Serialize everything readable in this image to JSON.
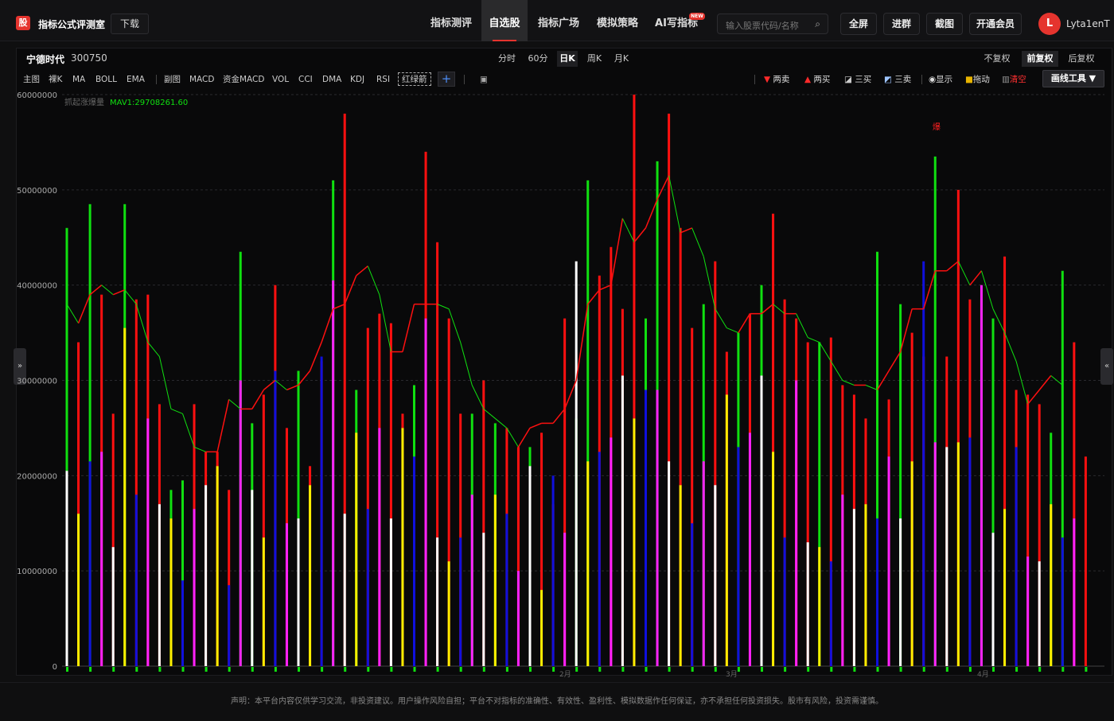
{
  "app": {
    "logo_char": "股",
    "title": "指标公式评测室",
    "download": "下载"
  },
  "nav": [
    {
      "label": "指标测评",
      "active": false
    },
    {
      "label": "自选股",
      "active": true
    },
    {
      "label": "指标广场",
      "active": false
    },
    {
      "label": "模拟策略",
      "active": false
    },
    {
      "label": "AI写指标",
      "active": false
    }
  ],
  "new_badge": "NEW",
  "search": {
    "placeholder": "输入股票代码/名称"
  },
  "top_buttons": [
    "全屏",
    "进群",
    "截图",
    "开通会员"
  ],
  "user": {
    "initial": "L",
    "name": "Lyta1enT"
  },
  "stock": {
    "name": "宁德时代",
    "code": "300750"
  },
  "periods": [
    {
      "label": "分时",
      "active": false
    },
    {
      "label": "60分",
      "active": false
    },
    {
      "label": "日K",
      "active": true
    },
    {
      "label": "周K",
      "active": false
    },
    {
      "label": "月K",
      "active": false
    }
  ],
  "adjust": [
    {
      "label": "不复权",
      "active": false
    },
    {
      "label": "前复权",
      "active": true
    },
    {
      "label": "后复权",
      "active": false
    }
  ],
  "indicators_main": [
    "主图",
    "裸K",
    "MA",
    "BOLL",
    "EMA"
  ],
  "indicators_sub": [
    "副图",
    "MACD",
    "资金MACD",
    "VOL",
    "CCI",
    "DMA",
    "KDJ",
    "RSI"
  ],
  "indicator_boxed": "红绿箭",
  "tools": {
    "sell2": "两卖",
    "buy2": "两买",
    "buy3": "三买",
    "sell3": "三卖",
    "show": "显示",
    "drag": "拖动",
    "clear": "清空",
    "draw": "画线工具 ▼"
  },
  "legend": {
    "name": "抓起涨爆量",
    "mav": "MAV1:29708261.60"
  },
  "marker": "爆",
  "x_labels": [
    "2月",
    "3月",
    "4月"
  ],
  "disclaimer": "声明：本平台内容仅供学习交流，非投资建议。用户操作风险自担；平台不对指标的准确性、有效性、盈利性、模拟数据作任何保证，亦不承担任何投资损失。股市有风险，投资需谨慎。",
  "colors": {
    "up": "#ff1010",
    "down": "#10e010",
    "accent": "#e5342e"
  },
  "chart_data": {
    "type": "bar",
    "y_ticks": [
      "60000000",
      "50000000",
      "40000000",
      "30000000",
      "20000000",
      "10000000",
      "0"
    ],
    "ylim": [
      0,
      60000000
    ],
    "series": [
      {
        "name": "volume",
        "values": [
          46,
          34,
          48.5,
          39,
          26.5,
          48.5,
          38.5,
          39,
          27.5,
          18.5,
          19.5,
          27.5,
          22.5,
          22.5,
          18.5,
          43.5,
          25.5,
          28.5,
          40,
          25,
          31,
          21,
          32,
          51,
          58,
          29,
          35.5,
          37,
          36,
          26.5,
          29.5,
          54,
          44.5,
          36.5,
          26.5,
          26.5,
          30,
          25.5,
          25,
          23,
          23,
          24.5,
          17,
          36.5,
          26,
          51,
          41,
          44,
          37.5,
          60,
          36.5,
          53,
          58,
          46,
          35.5,
          38,
          42.5,
          33,
          35,
          37,
          40,
          47.5,
          38.5,
          36.5,
          34,
          34,
          34.5,
          29.5,
          28.5,
          26,
          43.5,
          28,
          38,
          35,
          32.5,
          53.5,
          32.5,
          50,
          38.5,
          38.5,
          36.5,
          43,
          29,
          28.5,
          27.5,
          24.5,
          41.5,
          34,
          22
        ]
      },
      {
        "name": "inner",
        "values": [
          20.5,
          16,
          21.5,
          22.5,
          12.5,
          35.5,
          18,
          26,
          17,
          15.5,
          9,
          16.5,
          19,
          21,
          8.5,
          30,
          18.5,
          13.5,
          31,
          15,
          15.5,
          19,
          32.5,
          40.5,
          16,
          24.5,
          16.5,
          25,
          15.5,
          25,
          22,
          36.5,
          13.5,
          11,
          13.5,
          18,
          14,
          18,
          16,
          10,
          21,
          8,
          20,
          14,
          42.5,
          21.5,
          22.5,
          24,
          30.5,
          26,
          29,
          29,
          21.5,
          19,
          15,
          21.5,
          19,
          28.5,
          23,
          24.5,
          30.5,
          22.5,
          13.5,
          30,
          13,
          12.5,
          11,
          18,
          16.5,
          17,
          15.5,
          22,
          15.5,
          21.5,
          42.5,
          23.5,
          23,
          23.5,
          24,
          40,
          14,
          16.5,
          23,
          11.5,
          11,
          17,
          13.5,
          15.5
        ]
      },
      {
        "name": "MAV1",
        "values": [
          38,
          36,
          39,
          40,
          39,
          39.5,
          38,
          34,
          32.5,
          27,
          26.5,
          23,
          22.5,
          22.5,
          28,
          27,
          27,
          29,
          30,
          29,
          29.5,
          31,
          34,
          37.5,
          38,
          41,
          42,
          39,
          33,
          33,
          38,
          38,
          38,
          37.5,
          34,
          29.5,
          27,
          26,
          25,
          23,
          25,
          25.5,
          25.5,
          27,
          30,
          38,
          39.5,
          40,
          47,
          44.5,
          46,
          49,
          51.5,
          45.5,
          46,
          43,
          37.5,
          35.5,
          35,
          37,
          37,
          38,
          37,
          37,
          34.5,
          34,
          32,
          30,
          29.5,
          29.5,
          29,
          31,
          33,
          37.5,
          37.5,
          41.5,
          41.5,
          42.5,
          40,
          41.5,
          37.5,
          35,
          32,
          27.5,
          29,
          30.5,
          29.5
        ]
      }
    ],
    "units": "millions"
  }
}
